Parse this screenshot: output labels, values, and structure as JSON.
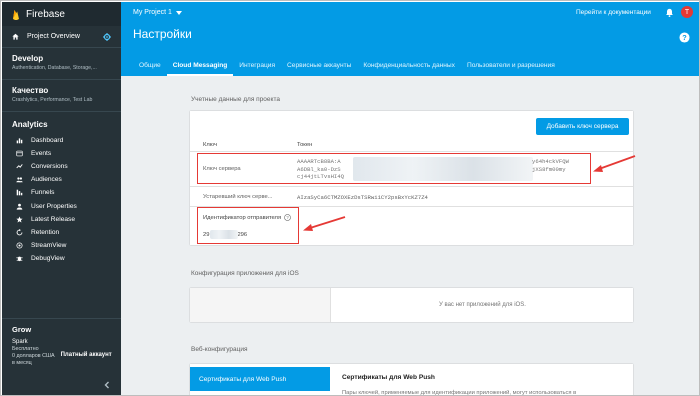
{
  "sidebar": {
    "brand": "Firebase",
    "overview": "Project Overview",
    "develop": {
      "title": "Develop",
      "sub": "Authentication, Database, Storage,..."
    },
    "quality": {
      "title": "Качество",
      "sub": "Crashlytics, Performance, Test Lab"
    },
    "analytics": {
      "title": "Analytics",
      "items": [
        {
          "label": "Dashboard",
          "icon": "dashboard-icon"
        },
        {
          "label": "Events",
          "icon": "events-icon"
        },
        {
          "label": "Conversions",
          "icon": "conversions-icon"
        },
        {
          "label": "Audiences",
          "icon": "audiences-icon"
        },
        {
          "label": "Funnels",
          "icon": "funnels-icon"
        },
        {
          "label": "User Properties",
          "icon": "user-properties-icon"
        },
        {
          "label": "Latest Release",
          "icon": "latest-release-icon"
        },
        {
          "label": "Retention",
          "icon": "retention-icon"
        },
        {
          "label": "StreamView",
          "icon": "streamview-icon"
        },
        {
          "label": "DebugView",
          "icon": "debugview-icon"
        }
      ]
    },
    "grow": "Grow",
    "plan": {
      "name": "Spark",
      "line1": "Бесплатно",
      "line2": "0 долларов США",
      "line3": "в месяц",
      "paid": "Платный аккаунт"
    }
  },
  "header": {
    "project": "My Project 1",
    "docs_link": "Перейти к документации",
    "avatar_letter": "T",
    "title": "Настройки",
    "tabs": [
      {
        "label": "Общие",
        "active": false
      },
      {
        "label": "Cloud Messaging",
        "active": true
      },
      {
        "label": "Интеграция",
        "active": false
      },
      {
        "label": "Сервисные аккаунты",
        "active": false
      },
      {
        "label": "Конфиденциальность данных",
        "active": false
      },
      {
        "label": "Пользователи и разрешения",
        "active": false
      }
    ]
  },
  "credentials": {
    "section_title": "Учетные данные для проекта",
    "add_button": "Добавить ключ сервера",
    "col_key": "Ключ",
    "col_token": "Токен",
    "server_key_label": "Ключ сервера",
    "server_token_lines_left": [
      "AAAARTcB8BA:A",
      "A6DBl_ka0-DzS",
      "cj44jtLTvsHI4Q"
    ],
    "server_token_lines_right": [
      "y64h4ckVFQW",
      "jXS8fm00my",
      ""
    ],
    "legacy_key_label": "Устаревший ключ серве...",
    "legacy_key_value": "AIzaSyCa6CTMZOXEzDsTSRwi1CY2psBxYcKZ7Z4",
    "sender_id_label": "Идентификатор отправителя",
    "sender_id_value_start": "29",
    "sender_id_value_end": "296"
  },
  "ios": {
    "section_title": "Конфигурация приложения для iOS",
    "empty": "У вас нет приложений для iOS."
  },
  "web": {
    "section_title": "Веб-конфигурация",
    "tab": "Сертификаты для Web Push",
    "card_title": "Сертификаты для Web Push",
    "card_text": "Пары ключей, применяемые для идентификации приложений, могут использоваться в"
  },
  "colors": {
    "sidebar": "#263238",
    "header": "#039be5",
    "highlight": "#e53935",
    "avatar": "#e53935"
  }
}
